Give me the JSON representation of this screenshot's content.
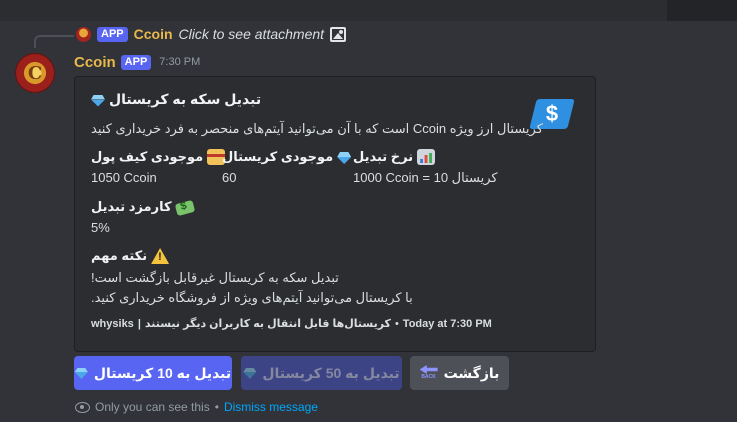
{
  "reply": {
    "badge": "APP",
    "author": "Ccoin",
    "text": "Click to see attachment",
    "icon": "image-icon"
  },
  "message": {
    "author": "Ccoin",
    "badge": "APP",
    "time": "7:30 PM",
    "avatar_letter": "C",
    "author_color": "#e9b84a"
  },
  "embed": {
    "title": "تبدیل سکه به کریستال",
    "title_icon": "diamond-icon",
    "description": "کریستال ارز ویژه Ccoin است که با آن می‌توانید آیتم‌های منحصر به فرد خریداری کنید",
    "thumbnail_icon": "dollar-bill-icon",
    "thumbnail_symbol": "$",
    "fields": [
      {
        "name": "نرخ تبدیل",
        "icon": "chart-icon",
        "value": "1000 Ccoin = 10 کریستال"
      },
      {
        "name": "موجودی کریستال",
        "icon": "diamond-icon",
        "value": "60"
      },
      {
        "name": "موجودی کیف پول",
        "icon": "credit-card-icon",
        "value": "1050 Ccoin"
      },
      {
        "name": "کارمزد تبدیل",
        "icon": "money-with-wings-icon",
        "value": "5%"
      }
    ],
    "note": {
      "title": "نکته مهم",
      "icon": "warning-icon",
      "lines": [
        "تبدیل سکه به کریستال غیرقابل بازگشت است!",
        "با کریستال می‌توانید آیتم‌های ویژه از فروشگاه خریداری کنید."
      ]
    },
    "footer": {
      "author": "whysiks",
      "separator": "|",
      "text": "کریستال‌ها قابل انتقال به کاربران دیگر نیستند",
      "dot": "•",
      "time": "Today at 7:30 PM"
    }
  },
  "buttons": [
    {
      "label": "تبدیل به 10 کریستال",
      "icon": "diamond-icon",
      "style": "primary",
      "disabled": false
    },
    {
      "label": "تبدیل به 50 کریستال",
      "icon": "diamond-icon",
      "style": "primary",
      "disabled": true
    },
    {
      "label": "بازگشت",
      "icon": "back-icon",
      "icon_text": "BACK",
      "style": "secondary",
      "disabled": false
    }
  ],
  "ephemeral": {
    "text": "Only you can see this",
    "dot": "•",
    "dismiss": "Dismiss message"
  },
  "colors": {
    "background": "#313338",
    "embed_bg": "#2b2d31",
    "blurple": "#5865f2",
    "link": "#00a8fc"
  }
}
